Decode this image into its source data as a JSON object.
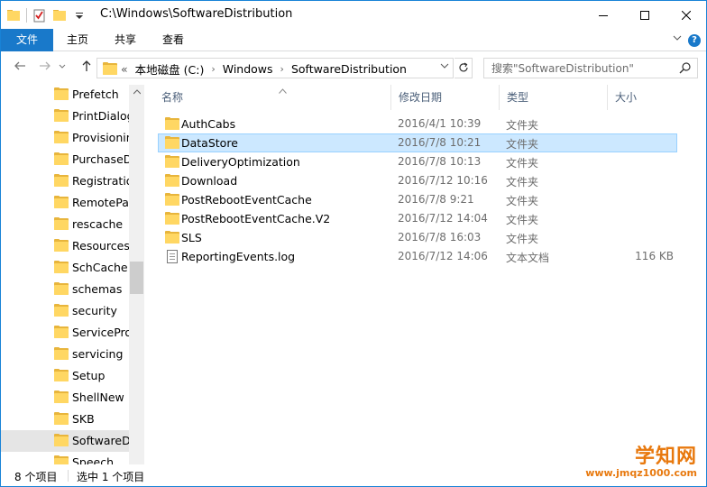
{
  "window": {
    "title": "C:\\Windows\\SoftwareDistribution",
    "controls": {
      "minimize": "—",
      "maximize": "☐",
      "close": "✕"
    }
  },
  "ribbon": {
    "tabs": [
      {
        "label": "文件"
      },
      {
        "label": "主页"
      },
      {
        "label": "共享"
      },
      {
        "label": "查看"
      }
    ],
    "help": "?"
  },
  "address": {
    "overflow": "«",
    "crumbs": [
      "本地磁盘 (C:)",
      "Windows",
      "SoftwareDistribution"
    ],
    "separator": "›"
  },
  "search": {
    "placeholder": "搜索\"SoftwareDistribution\""
  },
  "nav_pane": {
    "items": [
      {
        "label": "Prefetch"
      },
      {
        "label": "PrintDialog"
      },
      {
        "label": "Provisioning"
      },
      {
        "label": "PurchaseDialog"
      },
      {
        "label": "Registration"
      },
      {
        "label": "RemotePackages"
      },
      {
        "label": "rescache"
      },
      {
        "label": "Resources"
      },
      {
        "label": "SchCache"
      },
      {
        "label": "schemas"
      },
      {
        "label": "security"
      },
      {
        "label": "ServiceProfiles"
      },
      {
        "label": "servicing"
      },
      {
        "label": "Setup"
      },
      {
        "label": "ShellNew"
      },
      {
        "label": "SKB"
      },
      {
        "label": "SoftwareDistribution",
        "selected": true
      },
      {
        "label": "Speech"
      }
    ]
  },
  "file_list": {
    "columns": {
      "name": "名称",
      "date": "修改日期",
      "type": "类型",
      "size": "大小"
    },
    "rows": [
      {
        "name": "AuthCabs",
        "date": "2016/4/1 10:39",
        "type": "文件夹",
        "size": "",
        "icon": "folder"
      },
      {
        "name": "DataStore",
        "date": "2016/7/8 10:21",
        "type": "文件夹",
        "size": "",
        "icon": "folder",
        "selected": true
      },
      {
        "name": "DeliveryOptimization",
        "date": "2016/7/8 10:13",
        "type": "文件夹",
        "size": "",
        "icon": "folder"
      },
      {
        "name": "Download",
        "date": "2016/7/12 10:16",
        "type": "文件夹",
        "size": "",
        "icon": "folder"
      },
      {
        "name": "PostRebootEventCache",
        "date": "2016/7/8 9:21",
        "type": "文件夹",
        "size": "",
        "icon": "folder"
      },
      {
        "name": "PostRebootEventCache.V2",
        "date": "2016/7/12 14:04",
        "type": "文件夹",
        "size": "",
        "icon": "folder"
      },
      {
        "name": "SLS",
        "date": "2016/7/8 16:03",
        "type": "文件夹",
        "size": "",
        "icon": "folder"
      },
      {
        "name": "ReportingEvents.log",
        "date": "2016/7/12 14:06",
        "type": "文本文档",
        "size": "116 KB",
        "icon": "document"
      }
    ]
  },
  "status": {
    "count": "8 个项目",
    "selection": "选中 1 个项目"
  },
  "watermark": {
    "main": "学知网",
    "url": "www.jmqz1000.com"
  },
  "colors": {
    "accent": "#1979ca",
    "selection_bg": "#cce8ff",
    "selection_border": "#99d1ff",
    "folder": "#ffd763",
    "watermark": "#e8790e"
  }
}
